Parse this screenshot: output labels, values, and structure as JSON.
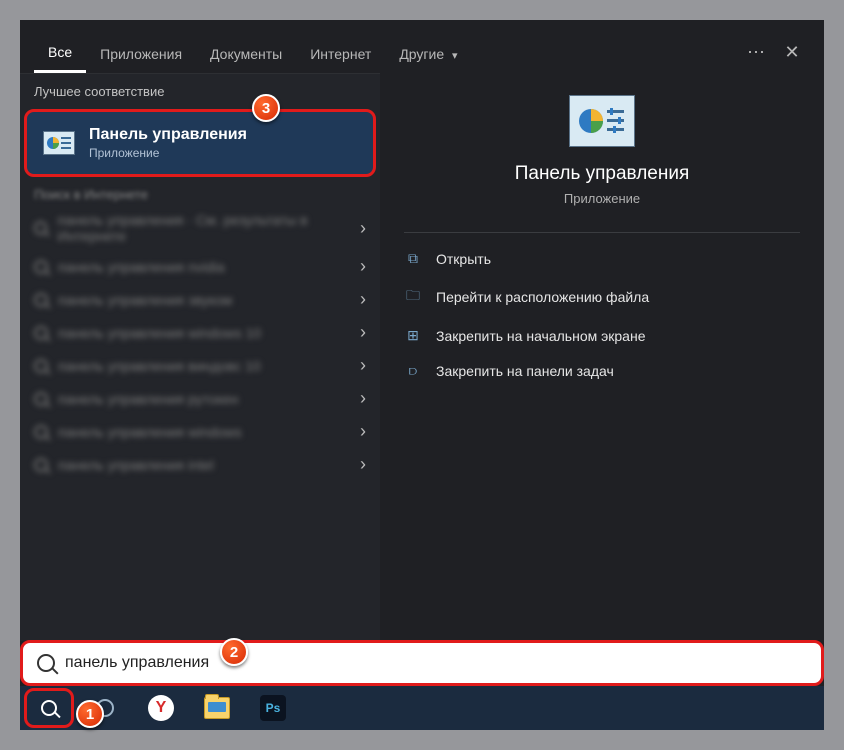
{
  "tabs": {
    "all": "Все",
    "apps": "Приложения",
    "docs": "Документы",
    "internet": "Интернет",
    "more": "Другие"
  },
  "left": {
    "best_match_header": "Лучшее соответствие",
    "best_match_title": "Панель управления",
    "best_match_subtitle": "Приложение",
    "web_header": "Поиск в Интернете",
    "blurred": [
      "панель управления · См. результаты в Интернете",
      "панель управления nvidia",
      "панель управления звуком",
      "панель управления windows 10",
      "панель управления виндовс 10",
      "панель управления рутокен",
      "панель управления windows",
      "панель управления intel"
    ]
  },
  "preview": {
    "title": "Панель управления",
    "subtitle": "Приложение",
    "actions": {
      "open": "Открыть",
      "goto": "Перейти к расположению файла",
      "pin_start": "Закрепить на начальном экране",
      "pin_taskbar": "Закрепить на панели задач"
    }
  },
  "search": {
    "query": "панель управления"
  },
  "badges": {
    "b1": "1",
    "b2": "2",
    "b3": "3"
  },
  "taskbar": {
    "ps": "Ps",
    "yandex": "Y"
  }
}
